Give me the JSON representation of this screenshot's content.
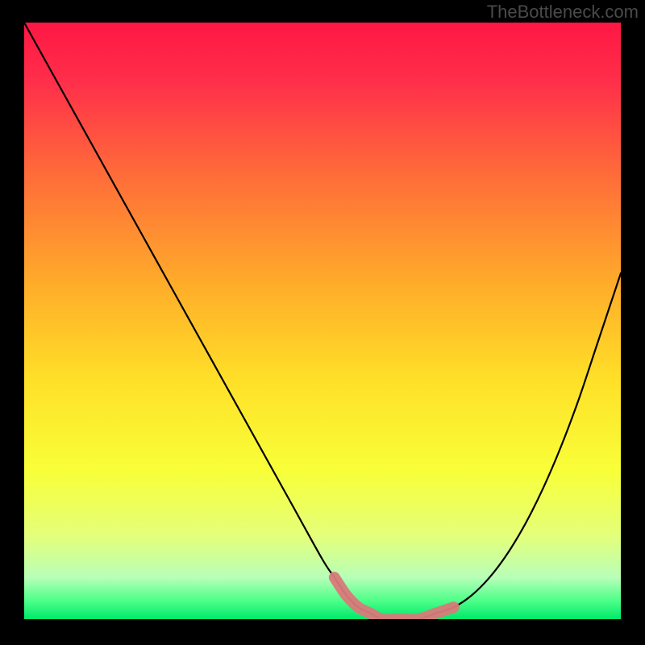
{
  "watermark": "TheBottleneck.com",
  "chart_data": {
    "type": "line",
    "title": "",
    "xlabel": "",
    "ylabel": "",
    "xlim": [
      0,
      100
    ],
    "ylim": [
      0,
      100
    ],
    "series": [
      {
        "name": "curve",
        "x": [
          0,
          5,
          10,
          15,
          20,
          25,
          30,
          35,
          40,
          45,
          50,
          52,
          54,
          56,
          58,
          60,
          63,
          66,
          69,
          72,
          75,
          78,
          81,
          84,
          87,
          90,
          93,
          96,
          100
        ],
        "values": [
          100,
          91,
          82,
          73,
          64,
          55,
          46,
          37,
          28,
          19,
          10,
          7,
          4,
          2,
          1,
          0,
          0,
          0,
          1,
          2,
          4,
          7,
          11,
          16,
          22,
          29,
          37,
          46,
          58
        ]
      }
    ],
    "highlight": {
      "name": "bottleneck-zone",
      "x": [
        52,
        54,
        56,
        58,
        60,
        63,
        66,
        69,
        72
      ],
      "values": [
        7,
        4,
        2,
        1,
        0,
        0,
        0,
        1,
        2
      ]
    },
    "background_gradient": {
      "stops": [
        {
          "pos": 0.0,
          "color": "#ff1744"
        },
        {
          "pos": 0.1,
          "color": "#ff2f4a"
        },
        {
          "pos": 0.25,
          "color": "#ff6a3a"
        },
        {
          "pos": 0.45,
          "color": "#ffb029"
        },
        {
          "pos": 0.6,
          "color": "#ffe028"
        },
        {
          "pos": 0.75,
          "color": "#f8ff38"
        },
        {
          "pos": 0.86,
          "color": "#e4ff7a"
        },
        {
          "pos": 0.93,
          "color": "#b8ffb8"
        },
        {
          "pos": 0.97,
          "color": "#4aff88"
        },
        {
          "pos": 1.0,
          "color": "#00e86a"
        }
      ]
    }
  }
}
